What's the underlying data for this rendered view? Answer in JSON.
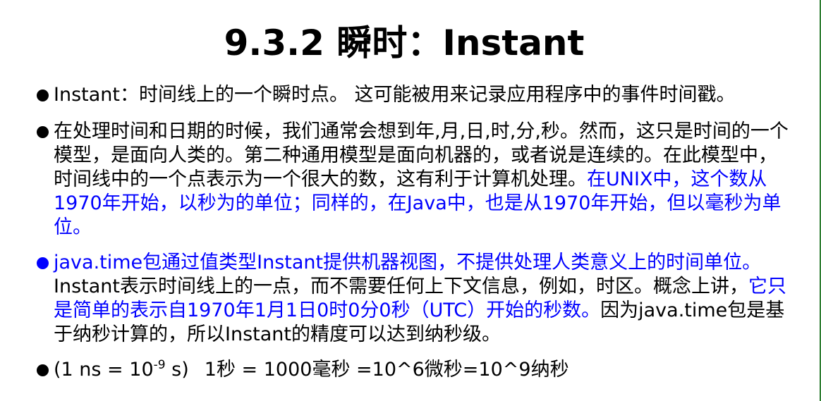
{
  "slide": {
    "title": "9.3.2 瞬时：Instant",
    "bullets": [
      {
        "text": "Instant：时间线上的一个瞬时点。 这可能被用来记录应用程序中的事件时间戳。"
      },
      {
        "text_black": "在处理时间和日期的时候，我们通常会想到年,月,日,时,分,秒。然而，这只是时间的一个模型，是面向人类的。第二种通用模型是面向机器的，或者说是连续的。在此模型中，时间线中的一个点表示为一个很大的数，这有利于计算机处理。",
        "text_blue": "在UNIX中，这个数从1970年开始，以秒为的单位；同样的，在Java中，也是从1970年开始，但以毫秒为单位。"
      },
      {
        "text_blue_1": "java.time包通过值类型Instant提供机器视图，不提供处理人类意义上的时间单位。",
        "text_black_1": "Instant表示时间线上的一点，而不需要任何上下文信息，例如，时区。概念上讲，",
        "text_blue_2": "它只是简单的表示自1970年1月1日0时0分0秒（UTC）开始的秒数。",
        "text_black_2": "因为java.time包是基于纳秒计算的，所以Instant的精度可以达到纳秒级。"
      },
      {
        "part_a": "(1 ns = 10",
        "sup": "-9",
        "part_b": " s)",
        "part_c": "1秒 = 1000毫秒 =10^6微秒=10^9纳秒"
      }
    ]
  }
}
